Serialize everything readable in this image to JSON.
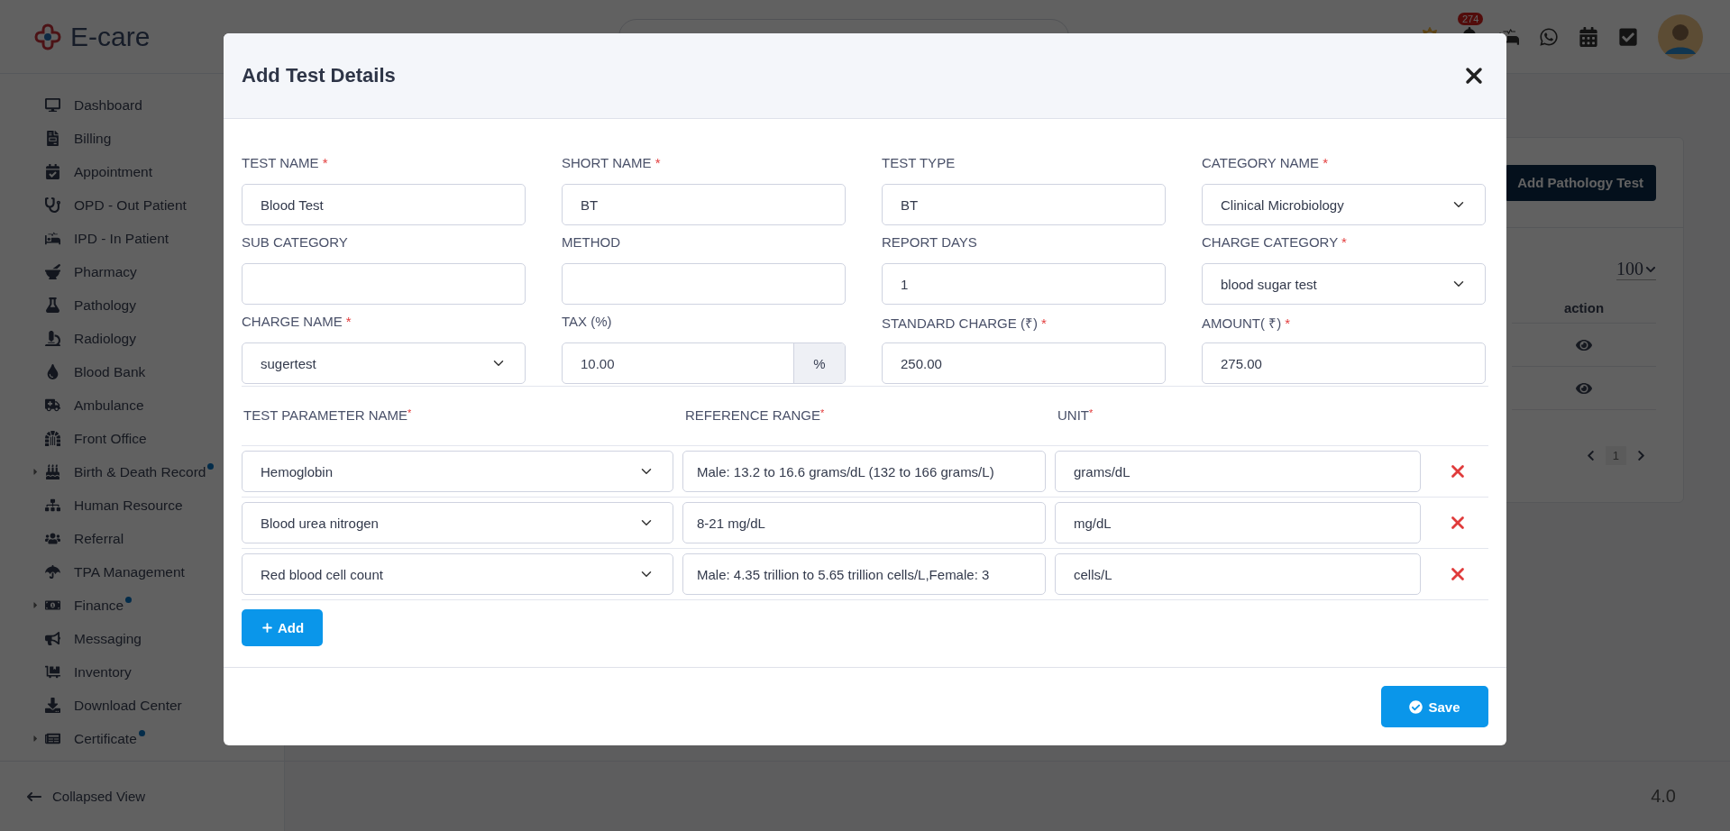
{
  "app": {
    "logo": "E-care",
    "notification_count": "274"
  },
  "sidebar": {
    "items": [
      {
        "label": "Dashboard",
        "expandable": false,
        "dot": false
      },
      {
        "label": "Billing",
        "expandable": false,
        "dot": false
      },
      {
        "label": "Appointment",
        "expandable": false,
        "dot": false
      },
      {
        "label": "OPD - Out Patient",
        "expandable": false,
        "dot": false
      },
      {
        "label": "IPD - In Patient",
        "expandable": false,
        "dot": false
      },
      {
        "label": "Pharmacy",
        "expandable": false,
        "dot": false
      },
      {
        "label": "Pathology",
        "expandable": false,
        "dot": false
      },
      {
        "label": "Radiology",
        "expandable": false,
        "dot": false
      },
      {
        "label": "Blood Bank",
        "expandable": false,
        "dot": false
      },
      {
        "label": "Ambulance",
        "expandable": false,
        "dot": false
      },
      {
        "label": "Front Office",
        "expandable": false,
        "dot": false
      },
      {
        "label": "Birth & Death Record",
        "expandable": true,
        "dot": true
      },
      {
        "label": "Human Resource",
        "expandable": false,
        "dot": false
      },
      {
        "label": "Referral",
        "expandable": false,
        "dot": false
      },
      {
        "label": "TPA Management",
        "expandable": false,
        "dot": false
      },
      {
        "label": "Finance",
        "expandable": true,
        "dot": true
      },
      {
        "label": "Messaging",
        "expandable": false,
        "dot": false
      },
      {
        "label": "Inventory",
        "expandable": false,
        "dot": false
      },
      {
        "label": "Download Center",
        "expandable": false,
        "dot": false
      },
      {
        "label": "Certificate",
        "expandable": true,
        "dot": true
      }
    ],
    "footer": "Collapsed View"
  },
  "background": {
    "add_button": "Add Pathology Test",
    "page_size": "100",
    "action_header": "action",
    "rows": [
      {
        "kind": "view"
      },
      {
        "kind": "view"
      }
    ],
    "page": "1",
    "version": "4.0"
  },
  "modal": {
    "title": "Add Test Details",
    "fields": [
      {
        "label": "TEST NAME",
        "required_mark": "*",
        "kind": "text",
        "value": "Blood Test"
      },
      {
        "label": "SHORT NAME",
        "required_mark": "*",
        "kind": "text",
        "value": "BT"
      },
      {
        "label": "TEST TYPE",
        "kind": "text",
        "value": "BT"
      },
      {
        "label": "CATEGORY NAME",
        "required_mark": "*",
        "kind": "select",
        "value": "Clinical Microbiology"
      },
      {
        "label": "SUB CATEGORY",
        "kind": "text"
      },
      {
        "label": "METHOD",
        "kind": "text"
      },
      {
        "label": "REPORT DAYS",
        "kind": "text",
        "value": "1"
      },
      {
        "label": "CHARGE CATEGORY",
        "required_mark": "*",
        "kind": "select",
        "value": "blood sugar test"
      },
      {
        "label": "CHARGE NAME",
        "required_mark": "*",
        "kind": "select",
        "value": "sugertest"
      },
      {
        "label": "TAX (%)",
        "kind": "suffix",
        "value": "10.00",
        "suffix": "%"
      },
      {
        "label": "STANDARD CHARGE (₹)",
        "required_mark": "*",
        "kind": "text",
        "value": "250.00"
      },
      {
        "label": "AMOUNT( ₹)",
        "required_mark": "*",
        "kind": "text",
        "value": "275.00"
      }
    ],
    "parameters": {
      "columns": [
        {
          "label": "TEST PARAMETER NAME",
          "required_mark": "*"
        },
        {
          "label": "REFERENCE RANGE",
          "required_mark": "*"
        },
        {
          "label": "UNIT",
          "required_mark": "*"
        }
      ],
      "rows": [
        {
          "name": "Hemoglobin",
          "range": "Male: 13.2 to 16.6 grams/dL (132 to 166 grams/L)",
          "unit": "grams/dL"
        },
        {
          "name": "Blood urea nitrogen",
          "range": "8-21 mg/dL",
          "unit": "mg/dL"
        },
        {
          "name": "Red blood cell count",
          "range": "Male: 4.35 trillion to 5.65 trillion cells/L,Female: 3",
          "unit": "cells/L"
        }
      ]
    },
    "add_button": "Add",
    "save_button": "Save"
  }
}
